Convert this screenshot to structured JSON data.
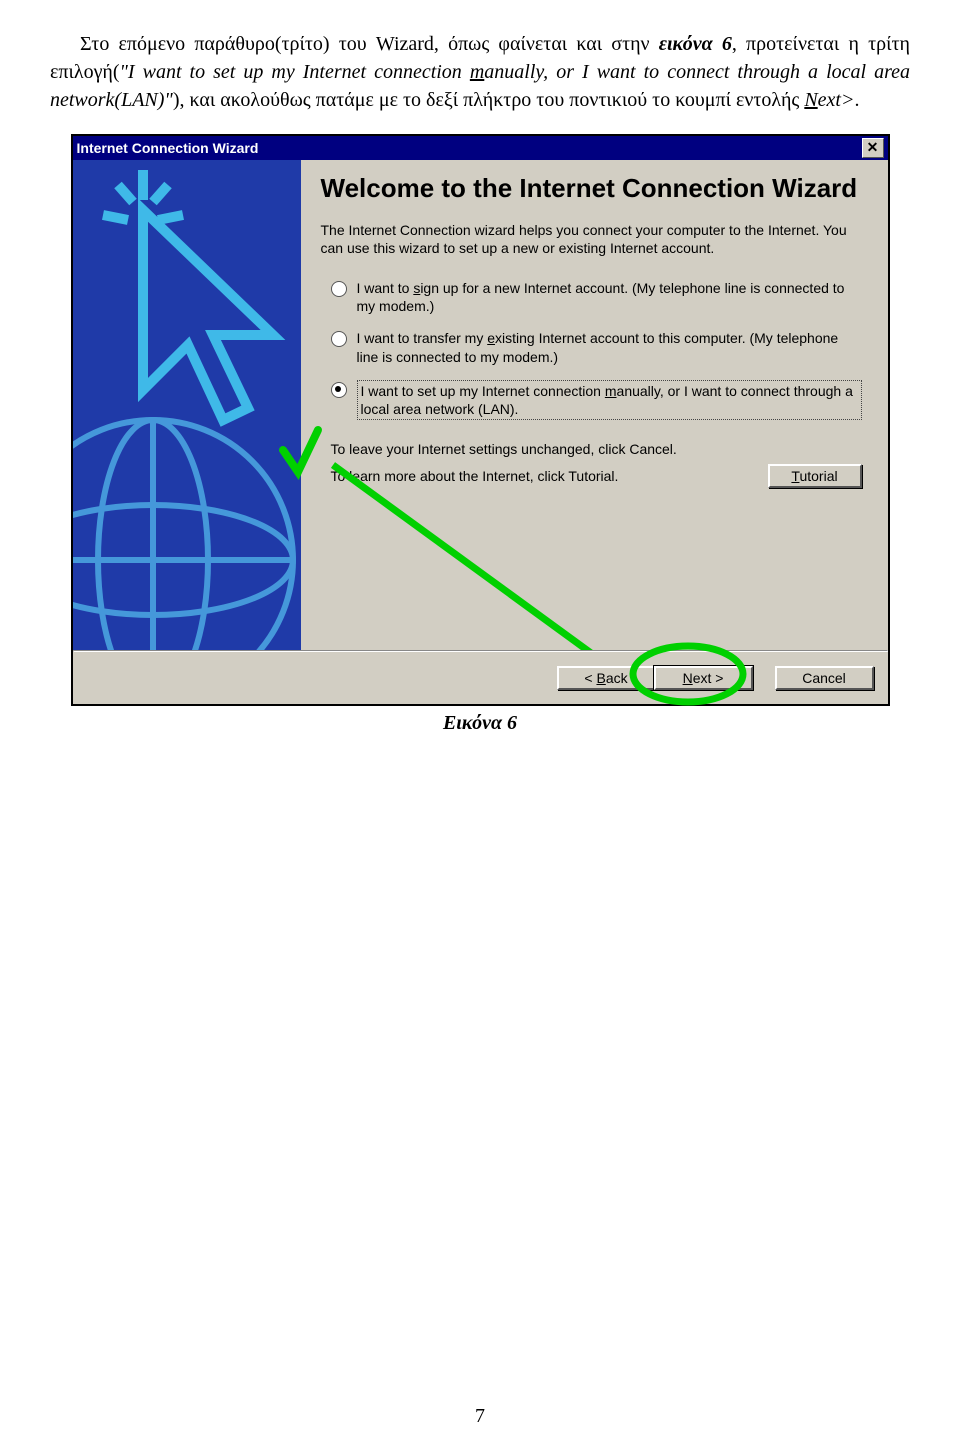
{
  "doc": {
    "para_html": "Στο επόμενο παράθυρο(τρίτο) του Wizard, όπως φαίνεται και στην <span class='bold italic'>εικόνα 6</span>, προτείνεται η τρίτη επιλογή(<span class='italic'>\"I want to set up my Internet connection <span class='underline'>m</span>anually, or I want to connect through a local area network(LAN)\"</span>), και ακολούθως πατάμε με το δεξί πλήκτρο του ποντικιού το κουμπί εντολής <span class='italic'><span class='underline'>N</span>ext&gt;</span>.",
    "caption": "Εικόνα 6",
    "page_number": "7"
  },
  "window": {
    "title": "Internet Connection Wizard",
    "close": "✕",
    "heading": "Welcome to the Internet Connection Wizard",
    "desc": "The Internet Connection wizard helps you connect your computer to the Internet.  You can use this wizard to set up a new or existing Internet account.",
    "options": [
      {
        "text_html": "I want to <u>s</u>ign up for a new Internet account. (My telephone line is connected to my modem.)",
        "selected": false
      },
      {
        "text_html": "I want to transfer my <u>e</u>xisting Internet account to this computer. (My telephone line is connected to my modem.)",
        "selected": false
      },
      {
        "text_html": "I want to set up my Internet connection <u>m</u>anually, or I want to connect through a local area network (LAN).",
        "selected": true
      }
    ],
    "footer1": "To leave your Internet settings unchanged, click Cancel.",
    "footer2": "To learn more about the Internet, click Tutorial.",
    "tutorial_html": "<u>T</u>utorial",
    "back_html": "&lt; <u>B</u>ack",
    "next_html": "<u>N</u>ext &gt;",
    "cancel": "Cancel"
  }
}
